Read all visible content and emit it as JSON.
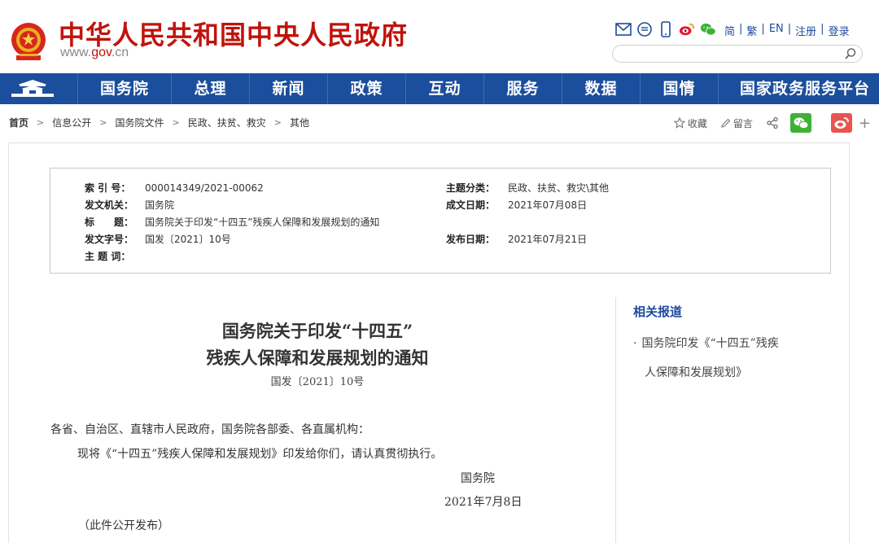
{
  "header": {
    "site_title": "中华人民共和国中央人民政府",
    "site_url_prefix": "www.",
    "site_url_brand": "gov",
    "site_url_suffix": ".cn",
    "top_links": [
      "简",
      "繁",
      "EN",
      "注册",
      "登录"
    ],
    "search_placeholder": ""
  },
  "nav": {
    "items": [
      "国务院",
      "总理",
      "新闻",
      "政策",
      "互动",
      "服务",
      "数据",
      "国情",
      "国家政务服务平台"
    ]
  },
  "breadcrumb": {
    "items": [
      "首页",
      "信息公开",
      "国务院文件",
      "民政、扶贫、救灾",
      "其他"
    ],
    "separator": ">"
  },
  "share": {
    "favorite_label": "收藏",
    "comment_label": "留言",
    "more_label": "+"
  },
  "meta": {
    "index_label": "索 引 号：",
    "index_value": "000014349/2021-00062",
    "topic_label": "主题分类：",
    "topic_value": "民政、扶贫、救灾\\其他",
    "issuer_label": "发文机关：",
    "issuer_value": "国务院",
    "written_label": "成文日期：",
    "written_value": "2021年07月08日",
    "title_label": "标　　题：",
    "title_value": "国务院关于印发“十四五”残疾人保障和发展规划的通知",
    "docno_label": "发文字号：",
    "docno_value": "国发〔2021〕10号",
    "published_label": "发布日期：",
    "published_value": "2021年07月21日",
    "keywords_label": "主 题 词：",
    "keywords_value": ""
  },
  "document": {
    "title_line1": "国务院关于印发“十四五”",
    "title_line2": "残疾人保障和发展规划的通知",
    "number": "国发〔2021〕10号",
    "salutation": "各省、自治区、直辖市人民政府，国务院各部委、各直属机构：",
    "body": "现将《“十四五”残疾人保障和发展规划》印发给你们，请认真贯彻执行。",
    "signer": "国务院",
    "date": "2021年7月8日",
    "note": "（此件公开发布）"
  },
  "related": {
    "title": "相关报道",
    "item_line1": "国务院印发《“十四五”残疾",
    "item_line2": "人保障和发展规划》"
  },
  "colors": {
    "brand_red": "#c0130d",
    "nav_blue": "#1b4e9c",
    "link_blue": "#1d4b9c"
  }
}
